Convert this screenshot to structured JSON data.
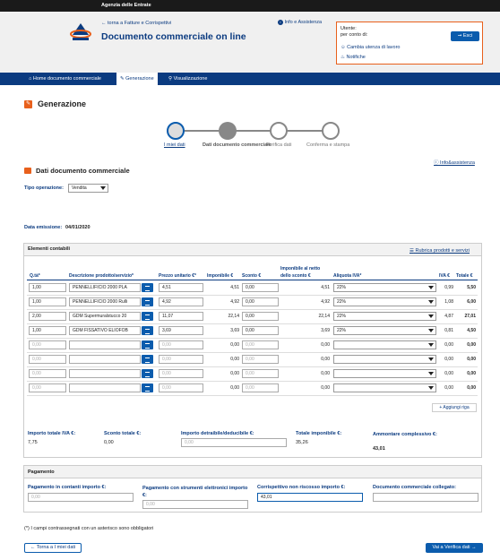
{
  "topbar": {
    "title": "Agenzia delle Entrate"
  },
  "header": {
    "back_link": "torna a Fatture e Corrispettivi",
    "page_title": "Documento commerciale on line",
    "info_link": "Info e Assistenza",
    "user_label": "Utente:",
    "on_behalf_label": "per conto di:",
    "exit_button": "Esci",
    "change_user": "Cambia utenza di lavoro",
    "notifications": "Notifiche"
  },
  "nav": {
    "home": "Home documento commerciale",
    "generazione": "Generazione",
    "visualizzazione": "Visualizzazione"
  },
  "section": {
    "title": "Generazione",
    "steps": [
      "I miei dati",
      "Dati documento commerciale",
      "Verifica dati",
      "Conferma e stampa"
    ],
    "data_title": "Dati documento commerciale",
    "info_link": "Info&assistenza",
    "tipo_label": "Tipo operazione:",
    "tipo_value": "Vendita",
    "emission_label": "Data emissione:",
    "emission_value": "04/01/2020"
  },
  "elementi": {
    "title": "Elementi contabili",
    "rubrica": "Rubrica prodotti e servizi",
    "headers": {
      "qty": "Q.tà*",
      "desc": "Descrizione prodotto/servizio*",
      "price": "Prezzo unitario €*",
      "imponibile": "Imponibile €",
      "sconto": "Sconto €",
      "netto": "Imponibile al netto dello sconto €",
      "aliquota": "Aliquota IVA*",
      "iva": "IVA €",
      "totale": "Totale €"
    },
    "rows": [
      {
        "qty": "1,00",
        "desc": "PENNELLIFICIO 2000 PLA",
        "price": "4,51",
        "imponibile": "4,51",
        "sconto": "0,00",
        "netto": "4,51",
        "aliquota": "22%",
        "iva": "0,99",
        "totale": "5,50",
        "filled": true
      },
      {
        "qty": "1,00",
        "desc": "PENNELLIFICIO 2000 Rulli",
        "price": "4,92",
        "imponibile": "4,92",
        "sconto": "0,00",
        "netto": "4,92",
        "aliquota": "22%",
        "iva": "1,08",
        "totale": "6,00",
        "filled": true
      },
      {
        "qty": "2,00",
        "desc": "GDM Supermuralstucco 20",
        "price": "11,07",
        "imponibile": "22,14",
        "sconto": "0,00",
        "netto": "22,14",
        "aliquota": "22%",
        "iva": "4,87",
        "totale": "27,01",
        "filled": true
      },
      {
        "qty": "1,00",
        "desc": "GDM FISSATIVO ELIOFOB",
        "price": "3,69",
        "imponibile": "3,69",
        "sconto": "0,00",
        "netto": "3,69",
        "aliquota": "22%",
        "iva": "0,81",
        "totale": "4,50",
        "filled": true
      },
      {
        "qty": "0,00",
        "desc": "",
        "price": "0,00",
        "imponibile": "0,00",
        "sconto": "0,00",
        "netto": "0,00",
        "aliquota": "",
        "iva": "0,00",
        "totale": "0,00",
        "filled": false
      },
      {
        "qty": "0,00",
        "desc": "",
        "price": "0,00",
        "imponibile": "0,00",
        "sconto": "0,00",
        "netto": "0,00",
        "aliquota": "",
        "iva": "0,00",
        "totale": "0,00",
        "filled": false
      },
      {
        "qty": "0,00",
        "desc": "",
        "price": "0,00",
        "imponibile": "0,00",
        "sconto": "0,00",
        "netto": "0,00",
        "aliquota": "",
        "iva": "0,00",
        "totale": "0,00",
        "filled": false
      },
      {
        "qty": "0,00",
        "desc": "",
        "price": "0,00",
        "imponibile": "0,00",
        "sconto": "0,00",
        "netto": "0,00",
        "aliquota": "",
        "iva": "0,00",
        "totale": "0,00",
        "filled": false
      }
    ],
    "add_row": "Aggiungi riga"
  },
  "totals": {
    "iva_label": "Importo totale IVA €:",
    "iva_value": "7,75",
    "sconto_label": "Sconto totale €:",
    "sconto_value": "0,00",
    "detraibile_label": "Importo detraibile/deducibile €:",
    "detraibile_placeholder": "0,00",
    "imponibile_label": "Totale imponibile €:",
    "imponibile_value": "35,26",
    "complessivo_label": "Ammontare complessivo €:",
    "complessivo_value": "43,01"
  },
  "pagamento": {
    "title": "Pagamento",
    "contanti_label": "Pagamento in contanti importo €:",
    "contanti_placeholder": "0,00",
    "elettronici_label": "Pagamento con strumenti elettronici importo €:",
    "elettronici_placeholder": "0,00",
    "non_riscosso_label": "Corrispettivo non riscosso importo €:",
    "non_riscosso_value": "43,01",
    "collegato_label": "Documento commerciale collegato:",
    "collegato_value": ""
  },
  "footer": {
    "note": "(*) I campi contrassegnati con un asterisco sono obbligatori",
    "back_button": "Torna a I miei dati",
    "next_button": "Vai a Verifica dati"
  },
  "colors": {
    "primary": "#0b3b80",
    "button": "#0b5cad",
    "accent": "#e8601c"
  }
}
